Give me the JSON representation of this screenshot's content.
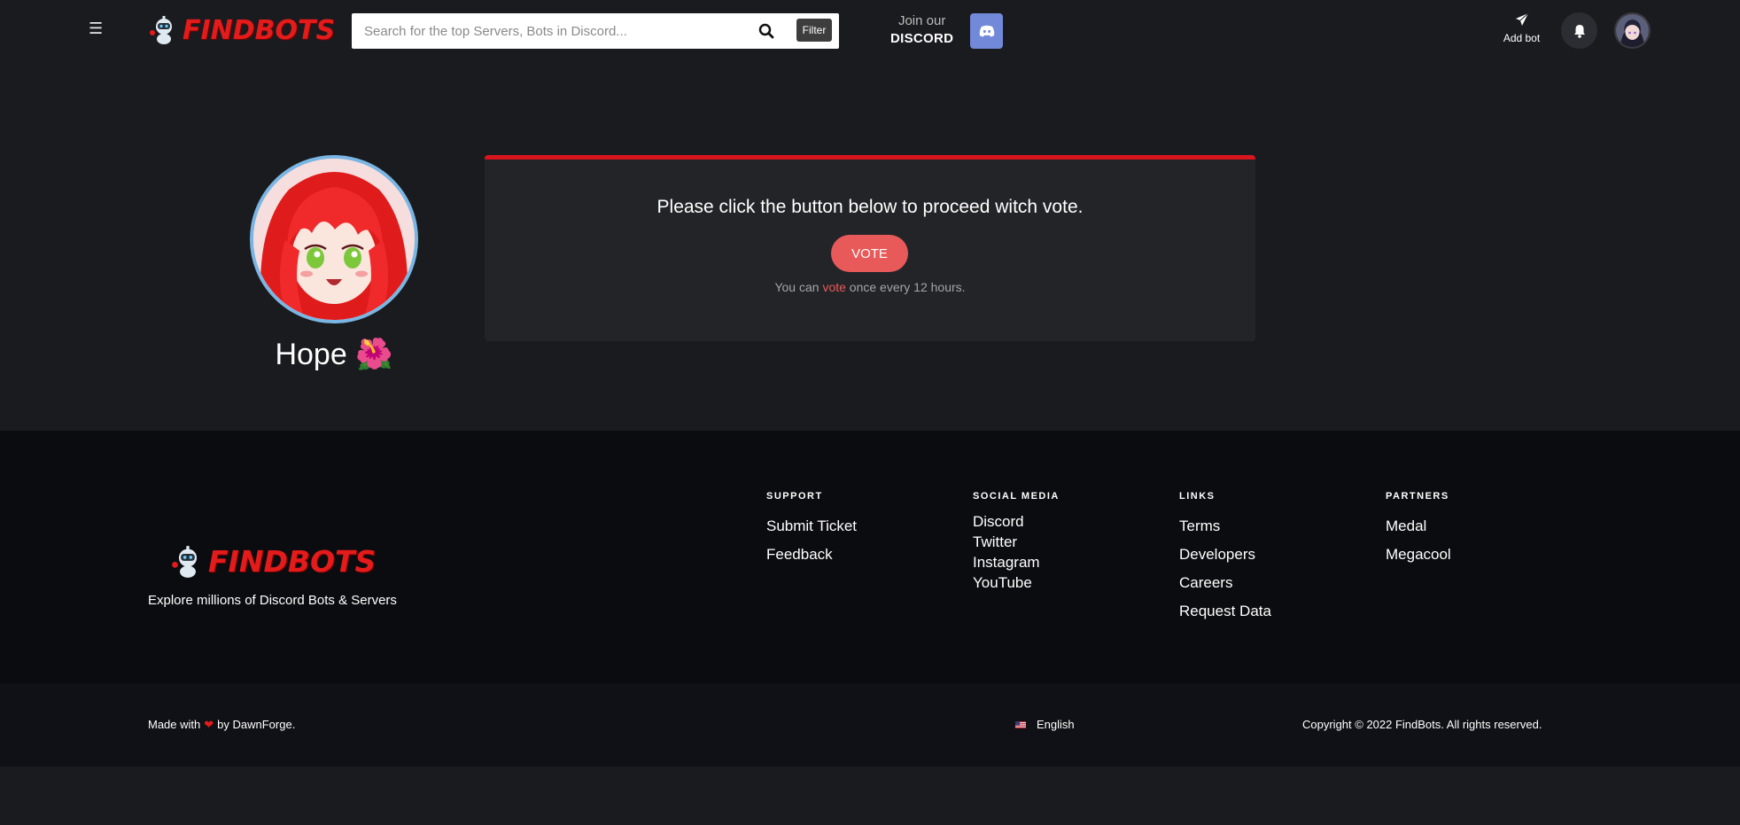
{
  "header": {
    "brand": "FINDBOTS",
    "search_placeholder": "Search for the top Servers, Bots in Discord...",
    "filter_label": "Filter",
    "join_line1": "Join our",
    "join_line2": "DISCORD",
    "add_bot_label": "Add bot"
  },
  "bot": {
    "name": "Hope 🌺"
  },
  "vote": {
    "heading": "Please click the button below to proceed witch vote.",
    "button_label": "VOTE",
    "note_prefix": "You can ",
    "note_accent": "vote",
    "note_suffix": " once every 12 hours."
  },
  "footer": {
    "brand": "FINDBOTS",
    "tagline": "Explore millions of Discord Bots & Servers",
    "columns": [
      {
        "title": "SUPPORT",
        "links": [
          "Submit Ticket",
          "Feedback"
        ]
      },
      {
        "title": "SOCIAL MEDIA",
        "links": [
          "Discord",
          "Twitter",
          "Instagram",
          "YouTube"
        ]
      },
      {
        "title": "LINKS",
        "links": [
          "Terms",
          "Developers",
          "Careers",
          "Request Data"
        ]
      },
      {
        "title": "PARTNERS",
        "links": [
          "Medal",
          "Megacool"
        ]
      }
    ],
    "made_prefix": "Made with",
    "made_suffix": "by DawnForge.",
    "language": "English",
    "copyright": "Copyright © 2022 FindBots. All rights reserved."
  },
  "colors": {
    "accent_red": "#e31b1b",
    "vote_button": "#e85a5a",
    "discord_blurple": "#7289da"
  }
}
